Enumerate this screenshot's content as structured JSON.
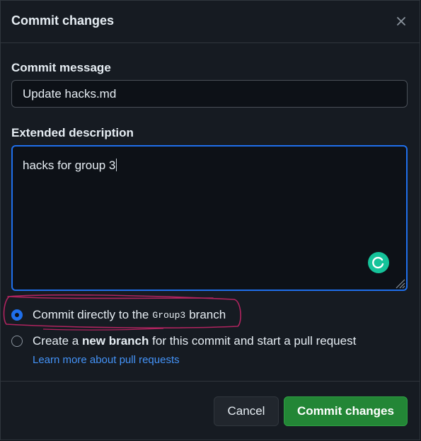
{
  "dialog": {
    "title": "Commit changes",
    "close_icon": "close-icon"
  },
  "commit_message": {
    "label": "Commit message",
    "value": "Update hacks.md"
  },
  "extended_description": {
    "label": "Extended description",
    "value": "hacks for group 3",
    "assistant_icon": "grammarly-icon"
  },
  "branch_options": {
    "direct": {
      "prefix": "Commit directly to the",
      "branch": "Group3",
      "suffix": "branch",
      "checked": true
    },
    "new_branch": {
      "prefix": "Create a",
      "bold": "new branch",
      "suffix": "for this commit and start a pull request",
      "checked": false
    },
    "learn_more": "Learn more about pull requests"
  },
  "actions": {
    "cancel": "Cancel",
    "commit": "Commit changes"
  },
  "colors": {
    "accent_blue": "#1f6feb",
    "commit_green": "#238636",
    "annotation_pink": "#b0245f",
    "link": "#4493f8"
  }
}
